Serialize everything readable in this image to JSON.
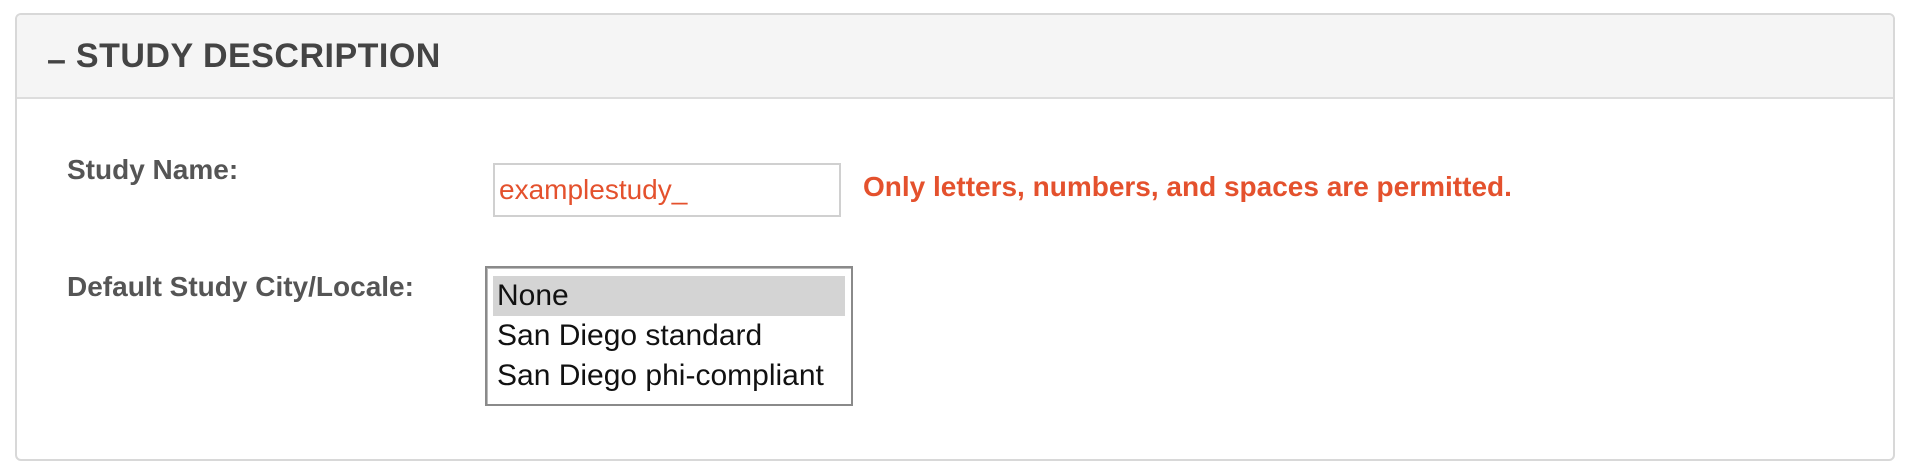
{
  "panel": {
    "collapse_glyph": "–",
    "title": "STUDY DESCRIPTION"
  },
  "form": {
    "study_name": {
      "label": "Study Name:",
      "value": "examplestudy_",
      "error": "Only letters, numbers, and spaces are permitted."
    },
    "locale": {
      "label": "Default Study City/Locale:",
      "options": [
        "None",
        "San Diego standard",
        "San Diego phi-compliant"
      ],
      "selected": "None"
    }
  },
  "colors": {
    "error": "#e4512d",
    "header_bg": "#f5f5f5",
    "label": "#555555",
    "selected_option_bg": "#d4d4d4"
  }
}
